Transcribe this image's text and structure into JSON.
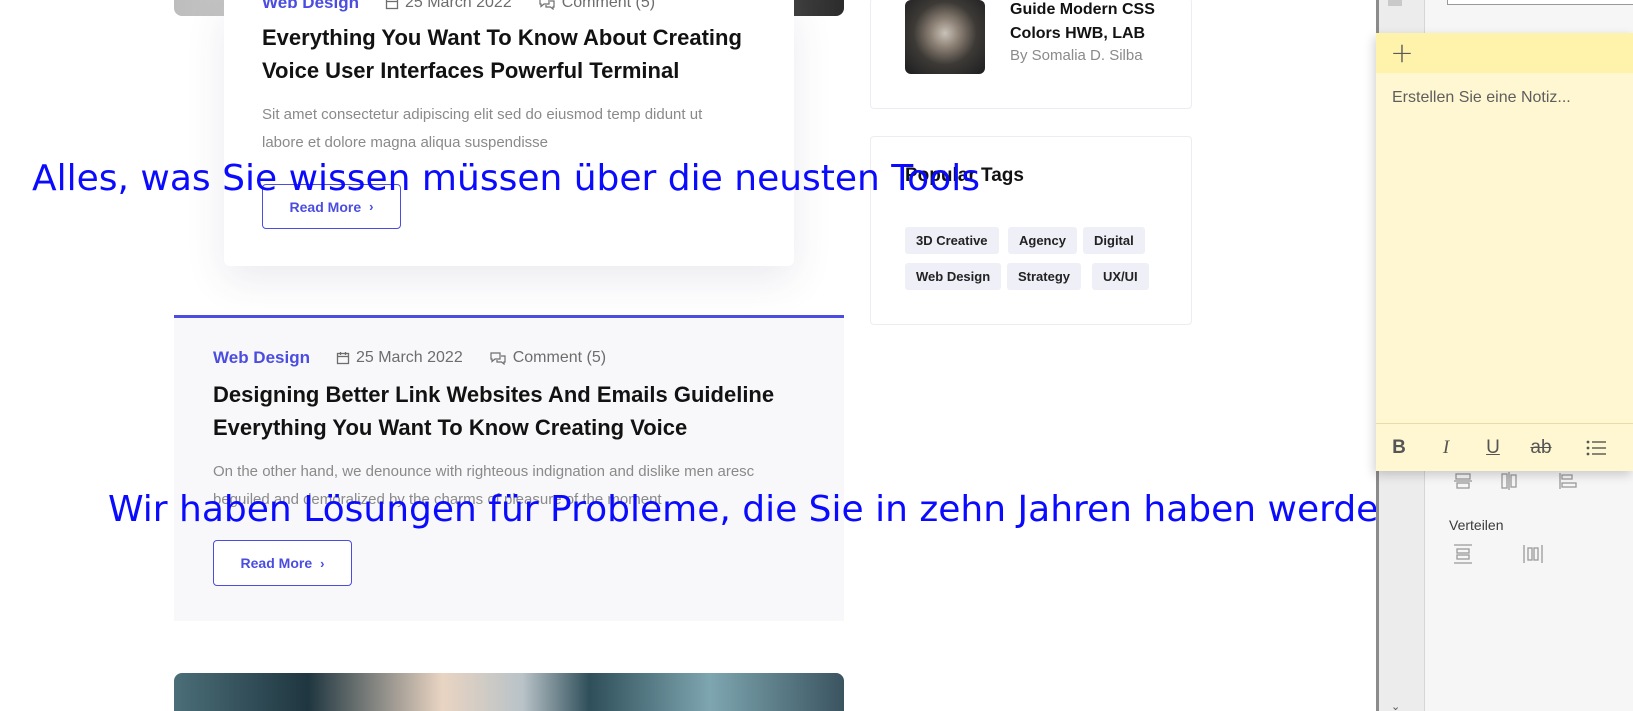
{
  "posts": [
    {
      "category": "Web Design",
      "date": "25 March 2022",
      "comments": "Comment (5)",
      "title_line1": "Everything You Want To Know About Creating",
      "title_line2": "Voice User Interfaces Powerful Terminal",
      "excerpt_line1": "Sit amet consectetur adipiscing elit sed do eiusmod temp didunt ut",
      "excerpt_line2": "labore et dolore magna aliqua suspendisse",
      "read_more": "Read More"
    },
    {
      "category": "Web Design",
      "date": "25 March 2022",
      "comments": "Comment (5)",
      "title_line1": "Designing Better Link Websites And Emails Guideline",
      "title_line2": "Everything You Want To Know Creating Voice",
      "excerpt_line1": "On the other hand, we denounce with righteous indignation and dislike men aresc",
      "excerpt_line2": "beguiled and demoralized by the charms of pleasure of the moment",
      "read_more": "Read More"
    }
  ],
  "sidebar": {
    "recent_post": {
      "title_line1": "Guide Modern CSS",
      "title_line2": "Colors HWB, LAB",
      "author": "By Somalia D. Silba"
    },
    "popular_tags": {
      "title": "Popular Tags",
      "tags": [
        "3D Creative",
        "Agency",
        "Digital",
        "Web Design",
        "Strategy",
        "UX/UI"
      ]
    }
  },
  "overlays": {
    "line1": "Alles, was Sie wissen müssen über die neusten Tools",
    "line2": "Wir haben Lösungen für Probleme, die Sie in zehn Jahren haben werden"
  },
  "sticky_note": {
    "add_icon": "+",
    "placeholder": "Erstellen Sie eine Notiz...",
    "toolbar": {
      "bold": "B",
      "italic": "I",
      "underline": "U",
      "strikethrough": "ab"
    }
  },
  "app_panel": {
    "distribute_label": "Verteilen"
  },
  "colors": {
    "accent": "#4b4de0",
    "overlay_text": "#0a0aff",
    "sticky_bg": "#fff7d1",
    "sticky_header": "#fff2ab"
  }
}
